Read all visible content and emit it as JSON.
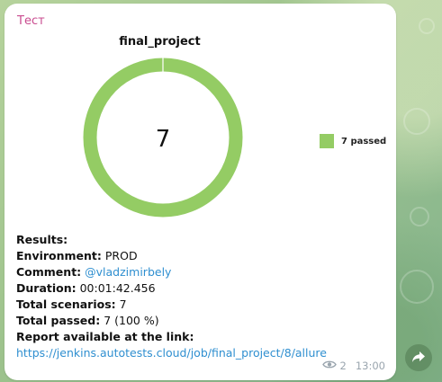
{
  "message": {
    "sender": "Тест",
    "views": "2",
    "time": "13:00"
  },
  "chart_data": {
    "type": "pie",
    "title": "final_project",
    "center_label": "7",
    "slices": [
      {
        "name": "passed",
        "value": 7,
        "color": "#94cc64"
      }
    ],
    "legend": [
      "7 passed"
    ],
    "legend_position": "right"
  },
  "results": {
    "heading": "Results:",
    "environment_label": "Environment:",
    "environment_value": "PROD",
    "comment_label": "Comment:",
    "comment_value": "@vladzimirbely",
    "duration_label": "Duration:",
    "duration_value": "00:01:42.456",
    "total_scenarios_label": "Total scenarios:",
    "total_scenarios_value": "7",
    "total_passed_label": "Total passed:",
    "total_passed_value": "7 (100 %)",
    "report_label": "Report available at the link:",
    "report_link": "https://jenkins.autotests.cloud/job/final_project/8/allure"
  },
  "icons": {
    "views": "eye-icon",
    "forward": "forward-arrow-icon"
  }
}
